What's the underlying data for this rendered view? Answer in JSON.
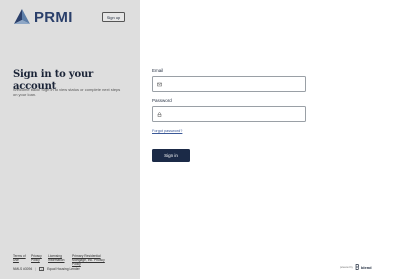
{
  "brand": {
    "name": "PRMI",
    "logo_icon": "prmi-triangle-logo",
    "color": "#2a3f6a"
  },
  "header": {
    "signup_label": "Sign up"
  },
  "intro": {
    "title": "Sign in to your account",
    "subtitle": "Welcome back! Sign in to view status or complete next steps on your loan."
  },
  "form": {
    "email_label": "Email",
    "email_icon": "mail-icon",
    "password_label": "Password",
    "password_icon": "lock-icon",
    "forgot_label": "Forgot password?",
    "signin_label": "Sign in",
    "button_color": "#1b2a47"
  },
  "footer": {
    "links": [
      "Terms of Use",
      "Privacy Policy",
      "Licensing Information",
      "Primary Residential Mortgage, Inc. Privacy Policy"
    ],
    "nmls": "NMLS #3094",
    "equal_housing": "Equal Housing Lender"
  },
  "powered_by": {
    "text": "powered by",
    "brand": "blend"
  }
}
